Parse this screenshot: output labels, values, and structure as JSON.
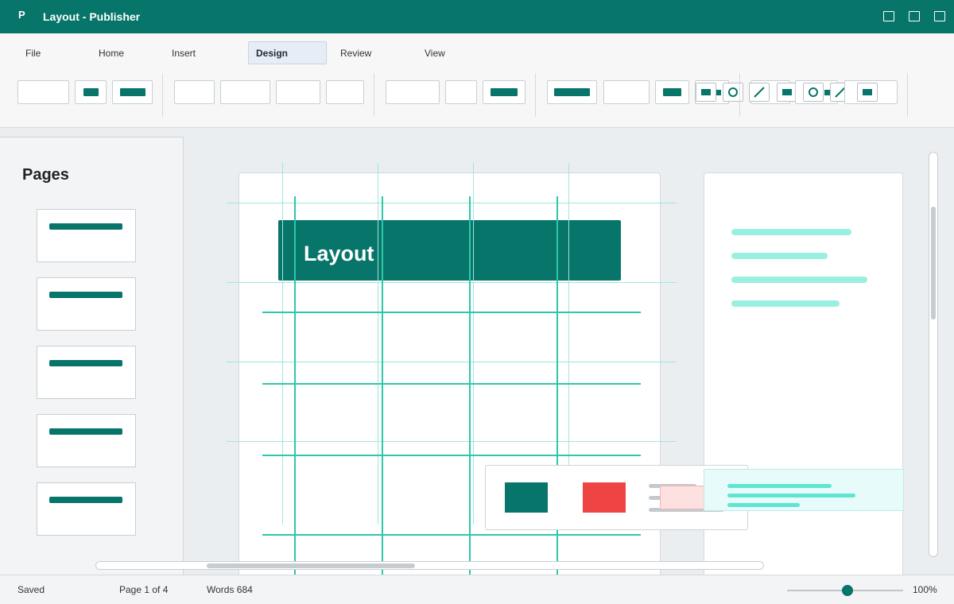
{
  "window": {
    "app_letter": "P",
    "title": "Layout - Publisher"
  },
  "menu": {
    "tabs": [
      {
        "label": "File"
      },
      {
        "label": "Home"
      },
      {
        "label": "Insert"
      },
      {
        "label": "Design",
        "active": true
      },
      {
        "label": "Review"
      },
      {
        "label": "View"
      }
    ]
  },
  "pages_pane": {
    "title": "Pages",
    "thumbnails": 5
  },
  "document": {
    "header_text": "Layout"
  },
  "colors": {
    "brand": "#07756a",
    "grid": "#2ec7a9",
    "guide": "#9fe7da",
    "accent_red": "#ef4444",
    "mint": "#9af0e0"
  },
  "status": {
    "saved": "Saved",
    "page": "Page 1 of 4",
    "words": "Words 684",
    "zoom": "100%",
    "zoom_level": 0.52
  }
}
